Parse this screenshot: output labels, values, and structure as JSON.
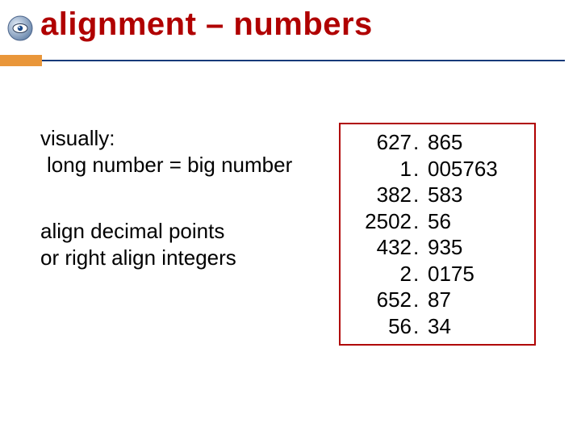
{
  "title": "alignment – numbers",
  "body": {
    "line1": "visually:",
    "line2": "long number = big number",
    "line3": "align decimal points",
    "line4": "or right align integers"
  },
  "numbers": [
    {
      "int": "627",
      "sep": ". ",
      "frac": "865"
    },
    {
      "int": "1",
      "sep": ". ",
      "frac": "005763"
    },
    {
      "int": "382",
      "sep": ". ",
      "frac": "583"
    },
    {
      "int": "2502",
      "sep": ". ",
      "frac": "56"
    },
    {
      "int": "432",
      "sep": ". ",
      "frac": "935"
    },
    {
      "int": "2",
      "sep": ". ",
      "frac": "0175"
    },
    {
      "int": "652",
      "sep": ". ",
      "frac": "87"
    },
    {
      "int": "56",
      "sep": ". ",
      "frac": "34"
    }
  ]
}
